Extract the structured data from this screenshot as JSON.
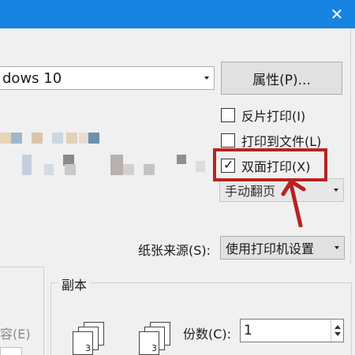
{
  "window": {
    "close_glyph": "✕"
  },
  "printer": {
    "selected": "dows 10",
    "properties_label": "属性(P)..."
  },
  "options": {
    "reverse_print": {
      "label": "反片打印(I)",
      "checked": false
    },
    "print_to_file": {
      "label": "打印到文件(L)",
      "checked": false
    },
    "duplex": {
      "label": "双面打印(X)",
      "checked": true,
      "tick": "✓"
    }
  },
  "duplex_mode": {
    "selected": "手动翻页"
  },
  "paper_source": {
    "label": "纸张来源(S):",
    "selected": "使用打印机设置"
  },
  "collate": {
    "label": "容(E)"
  },
  "copies": {
    "group_title": "副本",
    "label": "份数(C):",
    "value": "1",
    "page_number": "3"
  },
  "annotation": {
    "highlight_color": "#b72322"
  }
}
